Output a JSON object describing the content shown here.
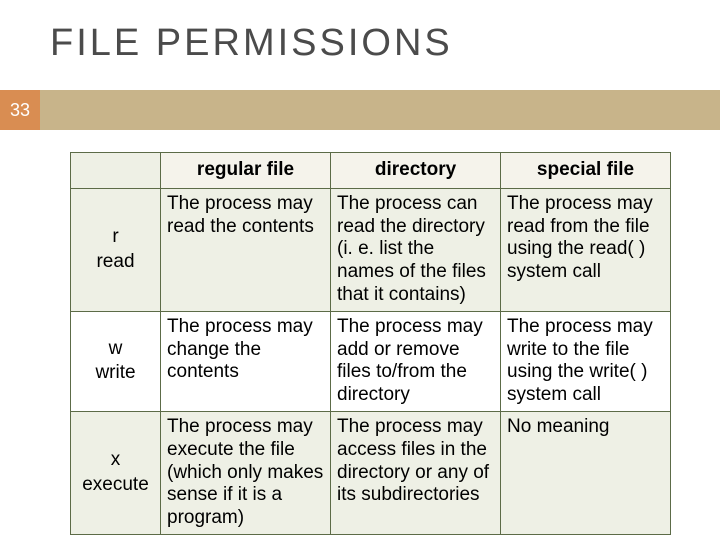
{
  "slide": {
    "title": "FILE  PERMISSIONS",
    "page_number": "33"
  },
  "table": {
    "headers": {
      "corner": "",
      "col1": "regular file",
      "col2": "directory",
      "col3": "special file"
    },
    "rows": [
      {
        "key_line1": "r",
        "key_line2": "read",
        "regular": "The process may read the contents",
        "directory": "The process can read the directory (i. e. list the names of the files that it contains)",
        "special": "The process may read from the file using the read( ) system call"
      },
      {
        "key_line1": "w",
        "key_line2": "write",
        "regular": "The process may change the contents",
        "directory": "The process may add  or remove files to/from the directory",
        "special": "The process may write to the file using the write( ) system call"
      },
      {
        "key_line1": "x",
        "key_line2": "execute",
        "regular": "The process may execute the file (which only makes sense if it is a program)",
        "directory": "The process may access files in the directory or any of its subdirectories",
        "special": "No meaning"
      }
    ]
  }
}
